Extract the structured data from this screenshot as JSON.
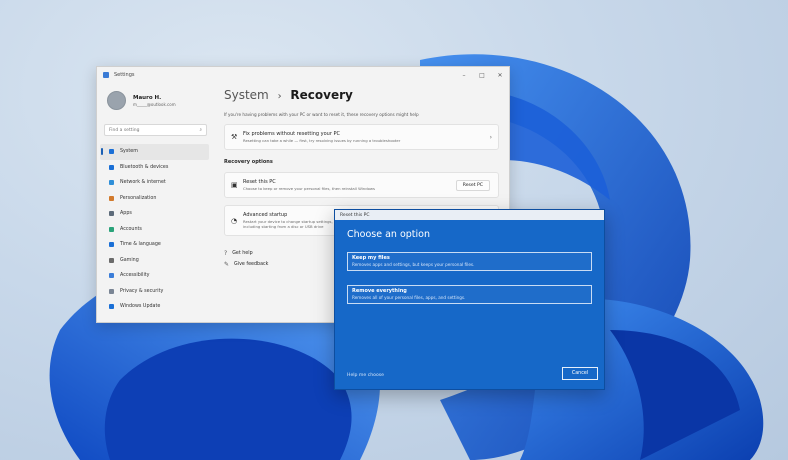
{
  "settings": {
    "window_title": "Settings",
    "profile": {
      "name": "Mauro H.",
      "email": "m_____@outlook.com"
    },
    "search_placeholder": "Find a setting",
    "nav": [
      {
        "label": "System",
        "icon": "monitor-icon",
        "color": "#1a6fd6",
        "active": true
      },
      {
        "label": "Bluetooth & devices",
        "icon": "bluetooth-icon",
        "color": "#1a6fd6"
      },
      {
        "label": "Network & internet",
        "icon": "network-icon",
        "color": "#2f8fd8"
      },
      {
        "label": "Personalization",
        "icon": "brush-icon",
        "color": "#d27a2c"
      },
      {
        "label": "Apps",
        "icon": "apps-icon",
        "color": "#5d6b7a"
      },
      {
        "label": "Accounts",
        "icon": "person-icon",
        "color": "#2aa37a"
      },
      {
        "label": "Time & language",
        "icon": "globe-icon",
        "color": "#1a6fd6"
      },
      {
        "label": "Gaming",
        "icon": "gamepad-icon",
        "color": "#6b6b6b"
      },
      {
        "label": "Accessibility",
        "icon": "accessibility-icon",
        "color": "#3b7dd8"
      },
      {
        "label": "Privacy & security",
        "icon": "shield-icon",
        "color": "#7a8594"
      },
      {
        "label": "Windows Update",
        "icon": "update-icon",
        "color": "#1a6fd6"
      }
    ],
    "breadcrumb": {
      "parent": "System",
      "current": "Recovery"
    },
    "intro": "If you're having problems with your PC or want to reset it, these recovery options might help",
    "troubleshoot": {
      "title": "Fix problems without resetting your PC",
      "desc": "Resetting can take a while — first, try resolving issues by running a troubleshooter"
    },
    "recovery_options_label": "Recovery options",
    "reset": {
      "title": "Reset this PC",
      "desc": "Choose to keep or remove your personal files, then reinstall Windows",
      "button": "Reset PC"
    },
    "advanced": {
      "title": "Advanced startup",
      "desc": "Restart your device to change startup settings, including starting from a disc or USB drive"
    },
    "links": [
      {
        "label": "Get help",
        "icon": "help-icon"
      },
      {
        "label": "Give feedback",
        "icon": "feedback-icon"
      }
    ]
  },
  "dialog": {
    "title": "Reset this PC",
    "heading": "Choose an option",
    "options": [
      {
        "title": "Keep my files",
        "desc": "Removes apps and settings, but keeps your personal files."
      },
      {
        "title": "Remove everything",
        "desc": "Removes all of your personal files, apps, and settings."
      }
    ],
    "help": "Help me choose",
    "cancel": "Cancel"
  }
}
